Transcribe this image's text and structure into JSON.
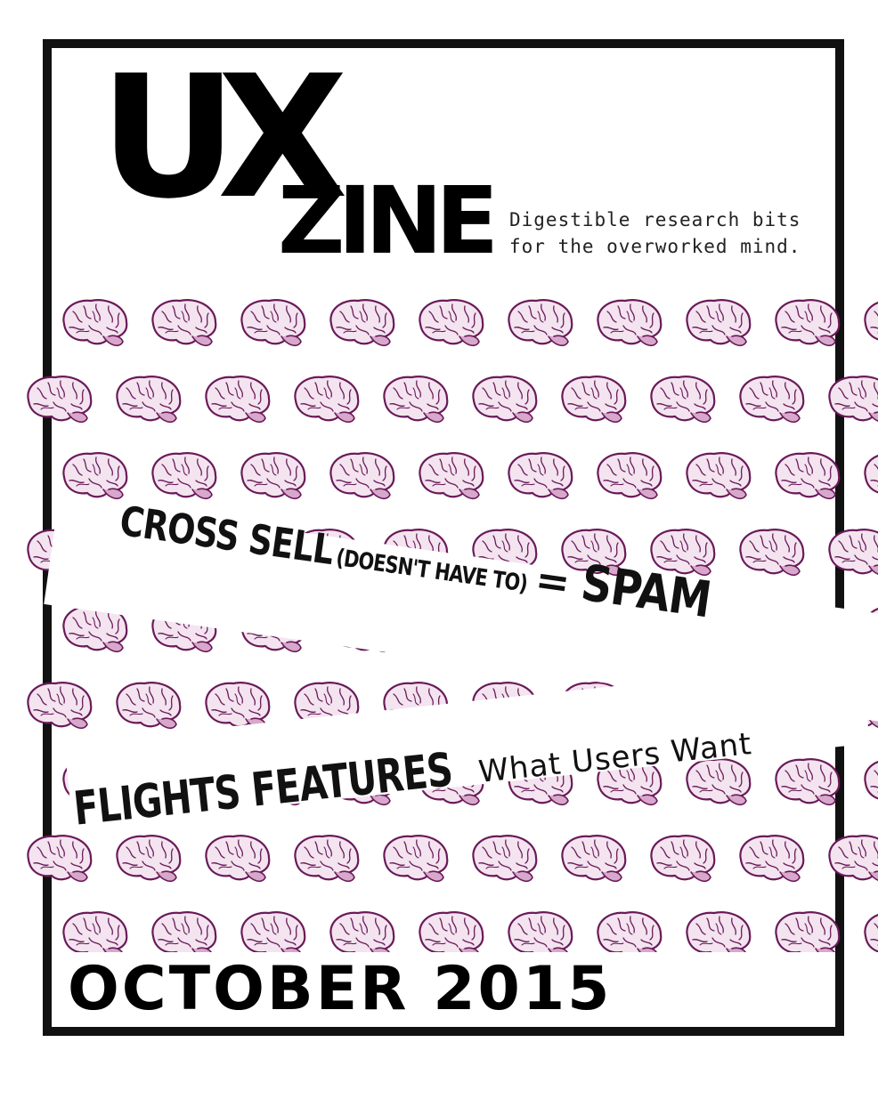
{
  "cover": {
    "logo_line1": "UX",
    "logo_line2": "ZINE",
    "tagline_line1": "Digestible research bits",
    "tagline_line2": "for the overworked mind.",
    "headline1": {
      "main": "CROSS SELL",
      "aside": "(DOESN'T HAVE TO)",
      "equals": "=",
      "end": "SPAM"
    },
    "headline2": {
      "main": "FLIGHTS FEATURES",
      "sub": "What Users Want"
    },
    "issue_date": "OCTOBER 2015"
  },
  "colors": {
    "brain_fill": "#f3e4f0",
    "brain_stroke": "#6a1a58",
    "frame": "#111111"
  },
  "icons": {
    "pattern": "brain-icon"
  }
}
